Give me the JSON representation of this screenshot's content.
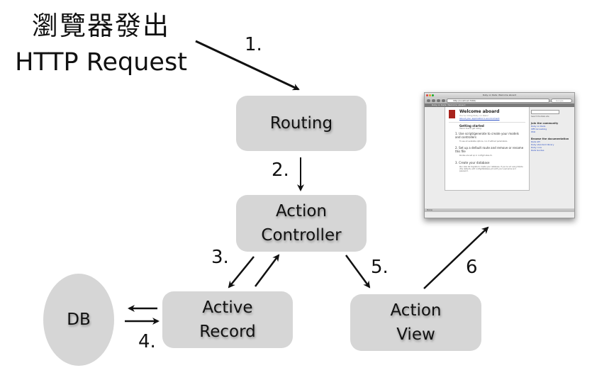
{
  "header": {
    "title_zh": "瀏覽器發出",
    "title_en": "HTTP Request"
  },
  "nodes": {
    "routing": [
      "Routing"
    ],
    "action_controller": [
      "Action",
      "Controller"
    ],
    "active_record": [
      "Active",
      "Record"
    ],
    "action_view": [
      "Action",
      "View"
    ],
    "db": "DB"
  },
  "steps": {
    "s1": "1.",
    "s2": "2.",
    "s3": "3.",
    "s4": "4.",
    "s5": "5.",
    "s6": "6"
  },
  "colors": {
    "node_fill": "#d6d6d6",
    "arrow": "#111111",
    "rails_red": "#a8231c",
    "link_blue": "#2b4fc4"
  },
  "browser": {
    "window_title": "Ruby on Rails: Welcome aboard",
    "url": "http://localhost:3000/",
    "search_placeholder": "Google",
    "tab_label": "Ruby on Rails: Welcome aboard",
    "status_text": "Done",
    "page": {
      "heading": "Welcome aboard",
      "subheading": "You're riding Ruby on Rails!",
      "env_link": "About your application's environment",
      "getting_started": "Getting started",
      "getting_started_sub": "Here's how to get rolling:",
      "steps": [
        {
          "title": "1. Use script/generate to create your models and controllers",
          "note": "To see all available options, run it without parameters."
        },
        {
          "title": "2. Set up a default route and remove or rename this file",
          "note": "Routes are set up in config/routes.rb."
        },
        {
          "title": "3. Create your database",
          "note": "Run rake db:migrate to create your database. If you're not using SQLite (the default), edit config/database.yml with your username and password."
        }
      ]
    },
    "sidebar": {
      "search_button": "Search",
      "search_scope": "the Rails site",
      "community_heading": "Join the community",
      "community_links": [
        "Ruby on Rails",
        "Official weblog",
        "Wiki"
      ],
      "docs_heading": "Browse the documentation",
      "docs_links": [
        "Rails API",
        "Ruby standard library",
        "Ruby core",
        "Rails Guides"
      ]
    }
  }
}
